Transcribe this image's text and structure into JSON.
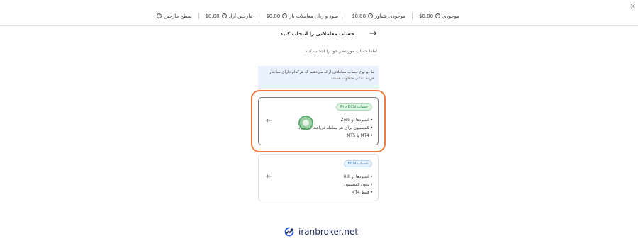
{
  "topbar": {
    "close_symbol": "×",
    "stats": [
      {
        "label": "موجودی",
        "value": "$0.00"
      },
      {
        "label": "موجودی شناور",
        "value": "$0.00"
      },
      {
        "label": "سود و زیان معاملات باز",
        "value": "$0.00"
      },
      {
        "label": "مارجین آزاد",
        "value": "$0.00"
      },
      {
        "label": "سطح مارجین",
        "value": "-"
      }
    ],
    "info_icon_glyph": "?"
  },
  "header": {
    "title": "حساب معاملاتی را انتخاب کنید",
    "subtitle": "لطفا حساب موردنظر خود را انتخاب کنید.",
    "back_icon": "arrow-right-icon"
  },
  "notice": {
    "text": "ما دو نوع حساب معاملاتی ارائه می‌دهیم که هرکدام دارای ساختار هزینه اندکی متفاوت هستند."
  },
  "accounts": [
    {
      "badge": "حساب Pro ECN",
      "features": [
        "اسپردها از Zero",
        "کمیسیون برای هر معامله دریافت می‌شود",
        "MT4 یا MT5"
      ],
      "highlighted": true
    },
    {
      "badge": "حساب ECN",
      "features": [
        "اسپردها از 0.8",
        "بدون کمیسیون",
        "فقط MT4"
      ],
      "highlighted": false
    }
  ],
  "footer": {
    "logo_text": "iranbroker.net"
  },
  "colors": {
    "highlight_border": "#ee7a3c",
    "notice_bg": "#e9f1fd",
    "pro_badge": "#2e8b4e",
    "ecn_badge": "#3376b4"
  }
}
